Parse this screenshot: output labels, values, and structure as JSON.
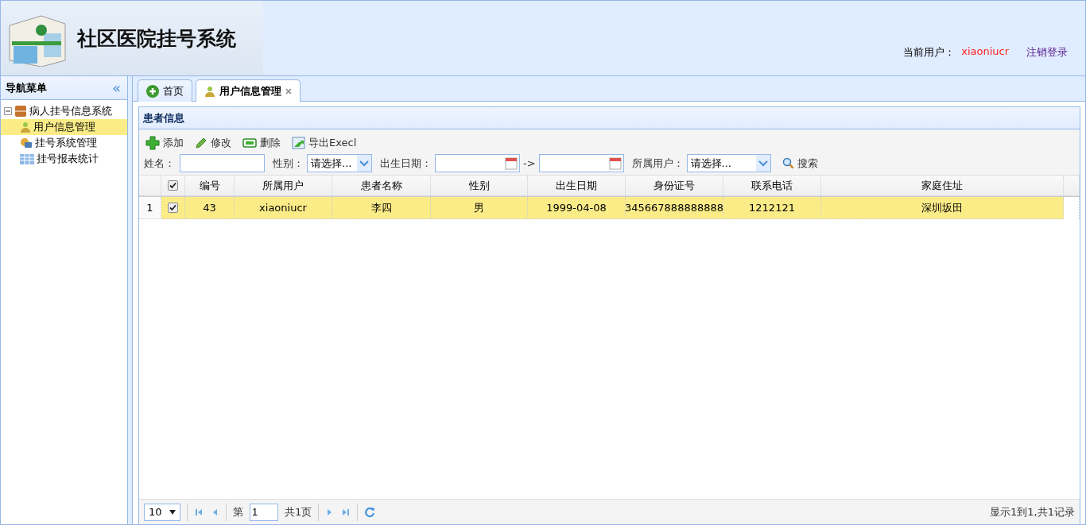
{
  "header": {
    "title": "社区医院挂号系统",
    "user_label": "当前用户：",
    "user_name": "xiaoniucr",
    "logout": "注销登录"
  },
  "sidebar": {
    "title": "导航菜单",
    "collapse": "«",
    "tree": [
      {
        "label": "病人挂号信息系统",
        "expanded": true,
        "children": [
          {
            "label": "用户信息管理",
            "selected": true
          },
          {
            "label": "挂号系统管理",
            "selected": false
          },
          {
            "label": "挂号报表统计",
            "selected": false
          }
        ]
      }
    ]
  },
  "tabs": [
    {
      "label": "首页",
      "selected": false,
      "closable": false
    },
    {
      "label": "用户信息管理",
      "selected": true,
      "closable": true
    }
  ],
  "panel": {
    "title": "患者信息",
    "toolbar": [
      {
        "label": "添加"
      },
      {
        "label": "修改"
      },
      {
        "label": "删除"
      },
      {
        "label": "导出Execl"
      }
    ],
    "filters": [
      {
        "kind": "text",
        "label": "姓名："
      },
      {
        "kind": "select",
        "label": "性别：",
        "value": "请选择..."
      },
      {
        "kind": "daterange",
        "label": "出生日期：",
        "separator": "->"
      },
      {
        "kind": "select",
        "label": "所属用户：",
        "value": "请选择..."
      }
    ],
    "search": "搜索",
    "table": {
      "header_checked": true,
      "columns": [
        "编号",
        "所属用户",
        "患者名称",
        "性别",
        "出生日期",
        "身份证号",
        "联系电话",
        "家庭住址"
      ],
      "rows": [
        {
          "index": "1",
          "checked": true,
          "selected": true,
          "cells": [
            "43",
            "xiaoniucr",
            "李四",
            "男",
            "1999-04-08",
            "345667888888888",
            "1212121",
            "深圳坂田"
          ]
        }
      ]
    },
    "pager": {
      "page_size": "10",
      "page_prefix": "第",
      "page": "1",
      "page_total": "共1页",
      "summary": "显示1到1,共1记录"
    }
  }
}
